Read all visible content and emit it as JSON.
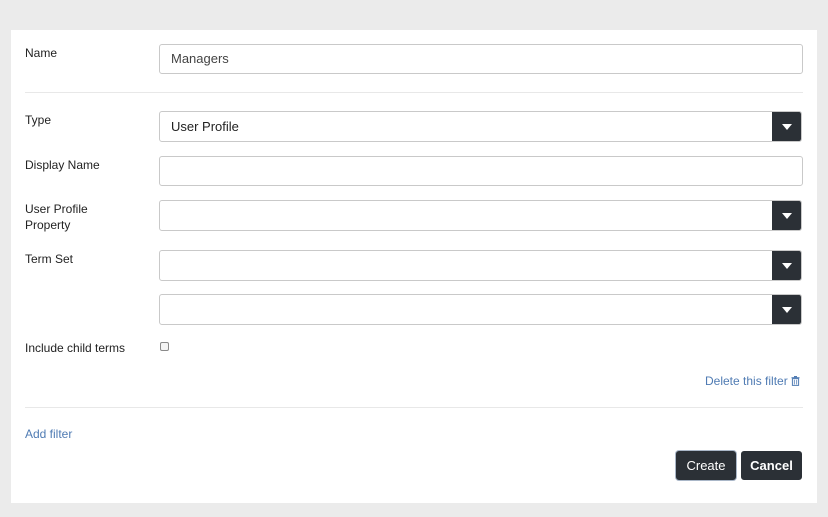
{
  "form": {
    "name_label": "Name",
    "name_value": "Managers",
    "type_label": "Type",
    "type_value": "User Profile",
    "display_name_label": "Display Name",
    "display_name_value": "",
    "user_profile_property_label_line1": "User Profile",
    "user_profile_property_label_line2": "Property",
    "user_profile_property_value": "",
    "term_set_label": "Term Set",
    "term_set_value": "",
    "term_value": "",
    "include_child_terms_label": "Include child terms",
    "include_child_terms_checked": false,
    "delete_filter_label": "Delete this filter"
  },
  "footer": {
    "add_filter_label": "Add filter",
    "create_label": "Create",
    "cancel_label": "Cancel"
  },
  "icons": {
    "dropdown": "caret-down-icon",
    "delete": "trash-icon"
  },
  "colors": {
    "background": "#ebebeb",
    "panel": "#ffffff",
    "dark_button": "#2b3036",
    "link": "#4f7bb3"
  }
}
